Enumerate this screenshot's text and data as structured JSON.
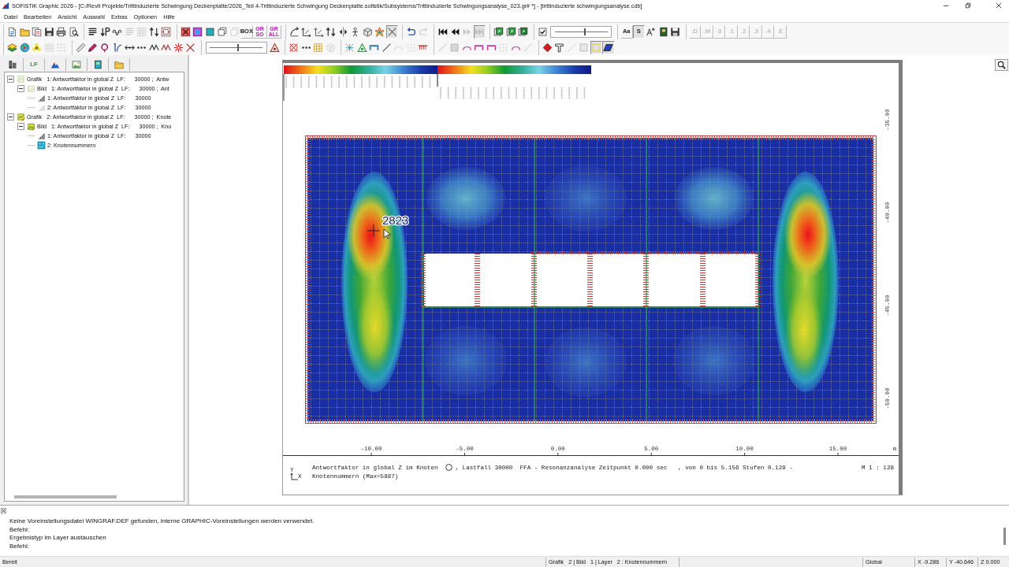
{
  "window": {
    "title": "SOFiSTiK Graphic 2026 - [C:/Revit Projekte/Trittinduzierte Schwingung Deckenplatte/2026_Teil 4-Trittinduzierte Schwingung Deckenplatte.sofistik/Subsystems/Trittinduzierte Schwingungsanalyse_023.gr# *] - [trittinduzierte schwingungsanalyse.cdb]"
  },
  "menu": [
    "Datei",
    "Bearbeiten",
    "Ansicht",
    "Auswahl",
    "Extras",
    "Optionen",
    "Hilfe"
  ],
  "toolbar_rows": [
    {
      "groups": [
        {
          "items": [
            {
              "kind": "icon",
              "disabled": false,
              "pressed": false
            },
            {
              "kind": "icon",
              "disabled": false,
              "pressed": false
            },
            {
              "kind": "icon",
              "disabled": false,
              "pressed": false
            },
            {
              "kind": "icon",
              "disabled": false,
              "pressed": false
            },
            {
              "kind": "icon",
              "disabled": false,
              "pressed": false
            },
            {
              "kind": "icon",
              "disabled": false,
              "pressed": false
            }
          ]
        },
        {
          "items": [
            {
              "kind": "icon",
              "disabled": false,
              "pressed": false
            },
            {
              "kind": "icon",
              "disabled": false,
              "pressed": false
            },
            {
              "kind": "icon",
              "disabled": false,
              "pressed": false
            },
            {
              "kind": "icon",
              "disabled": true,
              "pressed": false
            },
            {
              "kind": "icon",
              "disabled": true,
              "pressed": false
            },
            {
              "kind": "icon",
              "disabled": false,
              "pressed": false
            },
            {
              "kind": "icon",
              "disabled": false,
              "pressed": false
            }
          ]
        },
        {
          "items": [
            {
              "kind": "icon",
              "disabled": false,
              "pressed": false
            },
            {
              "kind": "icon",
              "disabled": false,
              "pressed": false
            },
            {
              "kind": "icon",
              "disabled": false,
              "pressed": false
            },
            {
              "kind": "icon",
              "disabled": false,
              "pressed": false
            },
            {
              "kind": "icon",
              "disabled": true,
              "pressed": false
            },
            {
              "kind": "label",
              "label": "BOX",
              "disabled": false,
              "pressed": false
            },
            {
              "kind": "label",
              "label": "GR SO",
              "disabled": false,
              "pressed": false
            },
            {
              "kind": "label",
              "label": "GR ALL",
              "disabled": false,
              "pressed": false
            }
          ]
        },
        {
          "items": [
            {
              "kind": "icon",
              "disabled": false,
              "pressed": false
            },
            {
              "kind": "icon",
              "disabled": false,
              "pressed": false
            },
            {
              "kind": "icon",
              "disabled": false,
              "pressed": false
            },
            {
              "kind": "icon",
              "disabled": false,
              "pressed": false
            },
            {
              "kind": "icon",
              "disabled": false,
              "pressed": false
            },
            {
              "kind": "icon",
              "disabled": false,
              "pressed": false
            },
            {
              "kind": "icon",
              "disabled": false,
              "pressed": false
            },
            {
              "kind": "icon",
              "disabled": false,
              "pressed": false
            },
            {
              "kind": "icon",
              "disabled": false,
              "pressed": true
            }
          ]
        },
        {
          "items": [
            {
              "kind": "icon",
              "disabled": false,
              "pressed": false
            },
            {
              "kind": "icon",
              "disabled": true,
              "pressed": false
            }
          ]
        },
        {
          "items": [
            {
              "kind": "icon",
              "disabled": false,
              "pressed": false
            },
            {
              "kind": "icon",
              "disabled": false,
              "pressed": false
            },
            {
              "kind": "icon",
              "disabled": true,
              "pressed": false
            },
            {
              "kind": "icon",
              "disabled": true,
              "pressed": true
            }
          ]
        },
        {
          "items": [
            {
              "kind": "icon",
              "disabled": false,
              "pressed": false
            },
            {
              "kind": "icon",
              "disabled": false,
              "pressed": false
            },
            {
              "kind": "icon",
              "disabled": false,
              "pressed": false
            }
          ]
        },
        {
          "items": [
            {
              "kind": "icon",
              "disabled": false,
              "pressed": false
            },
            {
              "kind": "slider",
              "level": 0.57
            }
          ]
        },
        {
          "items": [
            {
              "kind": "label",
              "label": "Aa",
              "disabled": false,
              "pressed": false
            },
            {
              "kind": "label",
              "label": "S",
              "disabled": false,
              "pressed": true
            },
            {
              "kind": "icon",
              "disabled": false,
              "pressed": false
            },
            {
              "kind": "icon",
              "disabled": false,
              "pressed": false
            },
            {
              "kind": "icon",
              "disabled": false,
              "pressed": false
            }
          ]
        },
        {
          "items": [
            {
              "kind": "label",
              "label": ".D",
              "disabled": true,
              "pressed": false
            },
            {
              "kind": "label",
              "label": ".M",
              "disabled": true,
              "pressed": false
            },
            {
              "kind": "label",
              "label": ".0",
              "disabled": true,
              "pressed": false
            },
            {
              "kind": "label",
              "label": ".1",
              "disabled": true,
              "pressed": false
            },
            {
              "kind": "label",
              "label": ".2",
              "disabled": true,
              "pressed": false
            },
            {
              "kind": "label",
              "label": ".3",
              "disabled": true,
              "pressed": false
            },
            {
              "kind": "label",
              "label": ".4",
              "disabled": true,
              "pressed": false
            },
            {
              "kind": "label",
              "label": ".E",
              "disabled": true,
              "pressed": false
            }
          ]
        }
      ]
    },
    {
      "groups": [
        {
          "items": [
            {
              "kind": "icon",
              "disabled": false,
              "pressed": false
            },
            {
              "kind": "icon",
              "disabled": false,
              "pressed": false
            },
            {
              "kind": "icon",
              "disabled": false,
              "pressed": false
            },
            {
              "kind": "icon",
              "disabled": true,
              "pressed": false
            },
            {
              "kind": "icon",
              "disabled": true,
              "pressed": false
            }
          ]
        },
        {
          "items": [
            {
              "kind": "icon",
              "disabled": false,
              "pressed": false
            },
            {
              "kind": "icon",
              "disabled": false,
              "pressed": false
            },
            {
              "kind": "icon",
              "disabled": false,
              "pressed": false
            },
            {
              "kind": "icon",
              "disabled": false,
              "pressed": false
            },
            {
              "kind": "icon",
              "disabled": false,
              "pressed": false
            },
            {
              "kind": "icon",
              "disabled": false,
              "pressed": false
            },
            {
              "kind": "icon",
              "disabled": false,
              "pressed": false
            },
            {
              "kind": "icon",
              "disabled": false,
              "pressed": false
            },
            {
              "kind": "icon",
              "disabled": false,
              "pressed": false
            },
            {
              "kind": "icon",
              "disabled": false,
              "pressed": false
            }
          ]
        },
        {
          "items": [
            {
              "kind": "slider",
              "level": 0.53
            },
            {
              "kind": "icon",
              "disabled": false,
              "pressed": false
            }
          ]
        },
        {
          "items": [
            {
              "kind": "icon",
              "disabled": false,
              "pressed": false
            },
            {
              "kind": "icon",
              "disabled": false,
              "pressed": false
            },
            {
              "kind": "icon",
              "disabled": false,
              "pressed": false
            },
            {
              "kind": "icon",
              "disabled": true,
              "pressed": false
            }
          ]
        },
        {
          "items": [
            {
              "kind": "icon",
              "disabled": false,
              "pressed": false
            },
            {
              "kind": "icon",
              "disabled": false,
              "pressed": false
            },
            {
              "kind": "icon",
              "disabled": false,
              "pressed": false
            },
            {
              "kind": "icon",
              "disabled": false,
              "pressed": false
            },
            {
              "kind": "icon",
              "disabled": true,
              "pressed": false
            },
            {
              "kind": "icon",
              "disabled": true,
              "pressed": false
            },
            {
              "kind": "icon",
              "disabled": false,
              "pressed": false
            }
          ]
        },
        {
          "items": [
            {
              "kind": "icon",
              "disabled": true,
              "pressed": false
            },
            {
              "kind": "icon",
              "disabled": true,
              "pressed": false
            },
            {
              "kind": "icon",
              "disabled": false,
              "pressed": false
            },
            {
              "kind": "icon",
              "disabled": false,
              "pressed": false
            },
            {
              "kind": "icon",
              "disabled": false,
              "pressed": false
            },
            {
              "kind": "icon",
              "disabled": true,
              "pressed": false
            },
            {
              "kind": "icon",
              "disabled": false,
              "pressed": false
            },
            {
              "kind": "icon",
              "disabled": true,
              "pressed": false
            }
          ]
        },
        {
          "items": [
            {
              "kind": "icon",
              "disabled": false,
              "pressed": false
            },
            {
              "kind": "icon",
              "disabled": false,
              "pressed": false
            },
            {
              "kind": "icon",
              "disabled": true,
              "pressed": false
            },
            {
              "kind": "icon",
              "disabled": true,
              "pressed": false
            },
            {
              "kind": "icon",
              "disabled": false,
              "pressed": true
            },
            {
              "kind": "icon",
              "disabled": false,
              "pressed": true
            }
          ]
        }
      ]
    }
  ],
  "side_panel": {
    "tabs": [
      {
        "kind": "icon"
      },
      {
        "kind": "text",
        "label": "LF"
      },
      {
        "kind": "icon"
      },
      {
        "kind": "icon"
      },
      {
        "kind": "icon"
      },
      {
        "kind": "icon"
      }
    ],
    "tree": [
      {
        "kind": "grafik",
        "label": "Grafik   1: Antwortfaktor in global Z  LF:      30000 ;  Antw",
        "active": false,
        "expanded": true,
        "children": [
          {
            "kind": "bild",
            "label": "Bild   1: Antwortfaktor in global Z  LF:      30000 ;  Ant",
            "active": false,
            "expanded": true,
            "children": [
              {
                "kind": "result",
                "label": "1: Antwortfaktor in global Z  LF:      30000",
                "active": true
              },
              {
                "kind": "result",
                "label": "2: Antwortfaktor in global Z  LF:      30000",
                "active": false
              }
            ]
          }
        ]
      },
      {
        "kind": "grafik",
        "label": "Grafik   2: Antwortfaktor in global Z  LF:      30000 ;  Knote",
        "active": true,
        "expanded": true,
        "children": [
          {
            "kind": "bild",
            "label": "Bild   1: Antwortfaktor in global Z  LF:      30000 ;  Kno",
            "active": true,
            "expanded": true,
            "children": [
              {
                "kind": "result",
                "label": "1: Antwortfaktor in global Z  LF:      30000",
                "active": true
              },
              {
                "kind": "labels",
                "label": "2: Knotennummern",
                "active": true
              }
            ]
          }
        ]
      }
    ]
  },
  "canvas": {
    "plot": {
      "node_label": "2823",
      "x_ticks": [
        "-10.00",
        "-5.00",
        "0.00",
        "5.00",
        "10.00",
        "15.00"
      ],
      "x_unit": "m",
      "y_ticks": [
        "-35.00",
        "-40.00",
        "-45.00",
        "-50.00"
      ]
    },
    "caption": {
      "axis_labels": [
        "Y",
        "X"
      ],
      "line_1_start": "Antwortfaktor in global Z im Knoten",
      "line_1_end": ", Lastfall 30000  FFA - Resonanzanalyse Zeitpunkt 0.000 sec   , von 0 bis 5.156 Stufen 0.129 -",
      "line_2": "Knotennummern (Max=5887)",
      "scale": "M 1 : 128"
    }
  },
  "console": {
    "lines": [
      "Keine Voreinstellungsdatei WINGRAF.DEF gefunden, interne GRAPHIC-Voreinstellungen werden verwendet.",
      "Befehl:",
      "Ergebnistyp im Layer austauschen",
      "Befehl:"
    ]
  },
  "status_bar": {
    "message": "Bereit",
    "layer_info": "Grafik   2 | Bild   1 | Layer   2 : Knotennummern",
    "coordinates": [
      "Global",
      "X -9.286",
      "Y -40.646",
      "Z 0.000"
    ]
  }
}
